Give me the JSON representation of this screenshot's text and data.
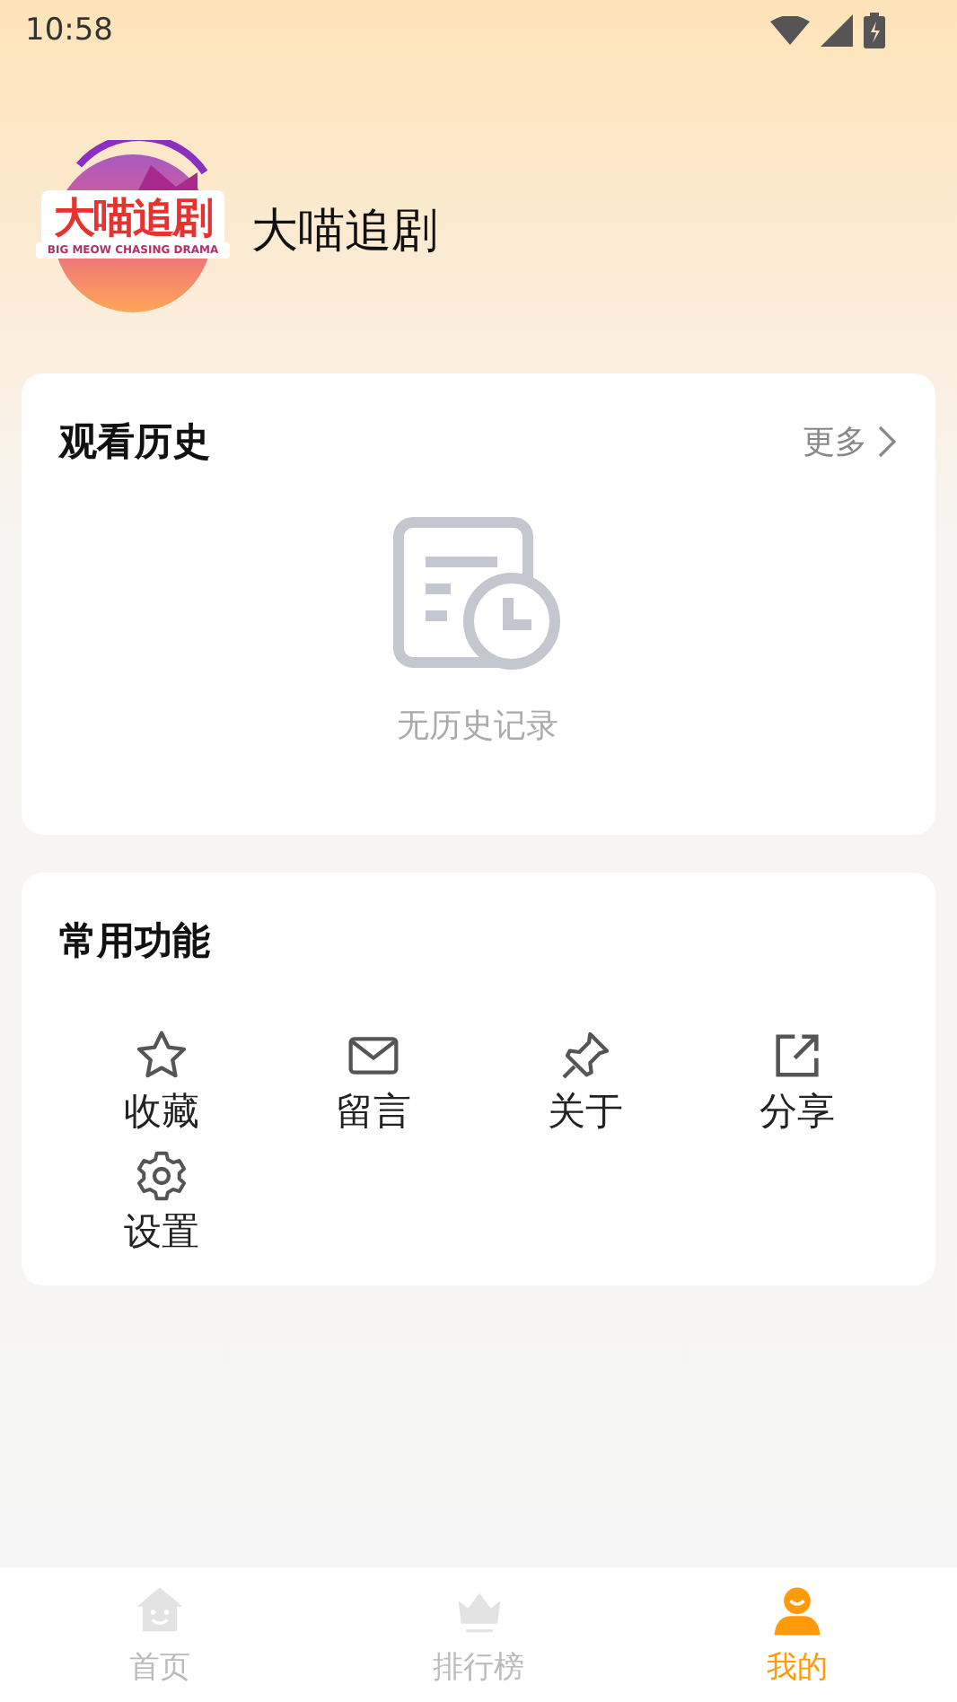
{
  "status_bar": {
    "time": "10:58"
  },
  "profile": {
    "logo_text": "大喵追剧",
    "logo_subtitle": "BIG MEOW CHASING DRAMA",
    "name": "大喵追剧"
  },
  "history": {
    "title": "观看历史",
    "more": "更多",
    "empty_text": "无历史记录"
  },
  "functions": {
    "title": "常用功能",
    "items": [
      {
        "kind": "star",
        "label": "收藏"
      },
      {
        "kind": "mail",
        "label": "留言"
      },
      {
        "kind": "pin",
        "label": "关于"
      },
      {
        "kind": "share",
        "label": "分享"
      },
      {
        "kind": "gear",
        "label": "设置"
      }
    ]
  },
  "tab_bar": [
    {
      "kind": "home",
      "label": "首页",
      "selected": false
    },
    {
      "kind": "crown",
      "label": "排行榜",
      "selected": false
    },
    {
      "kind": "user",
      "label": "我的",
      "selected": true
    }
  ]
}
